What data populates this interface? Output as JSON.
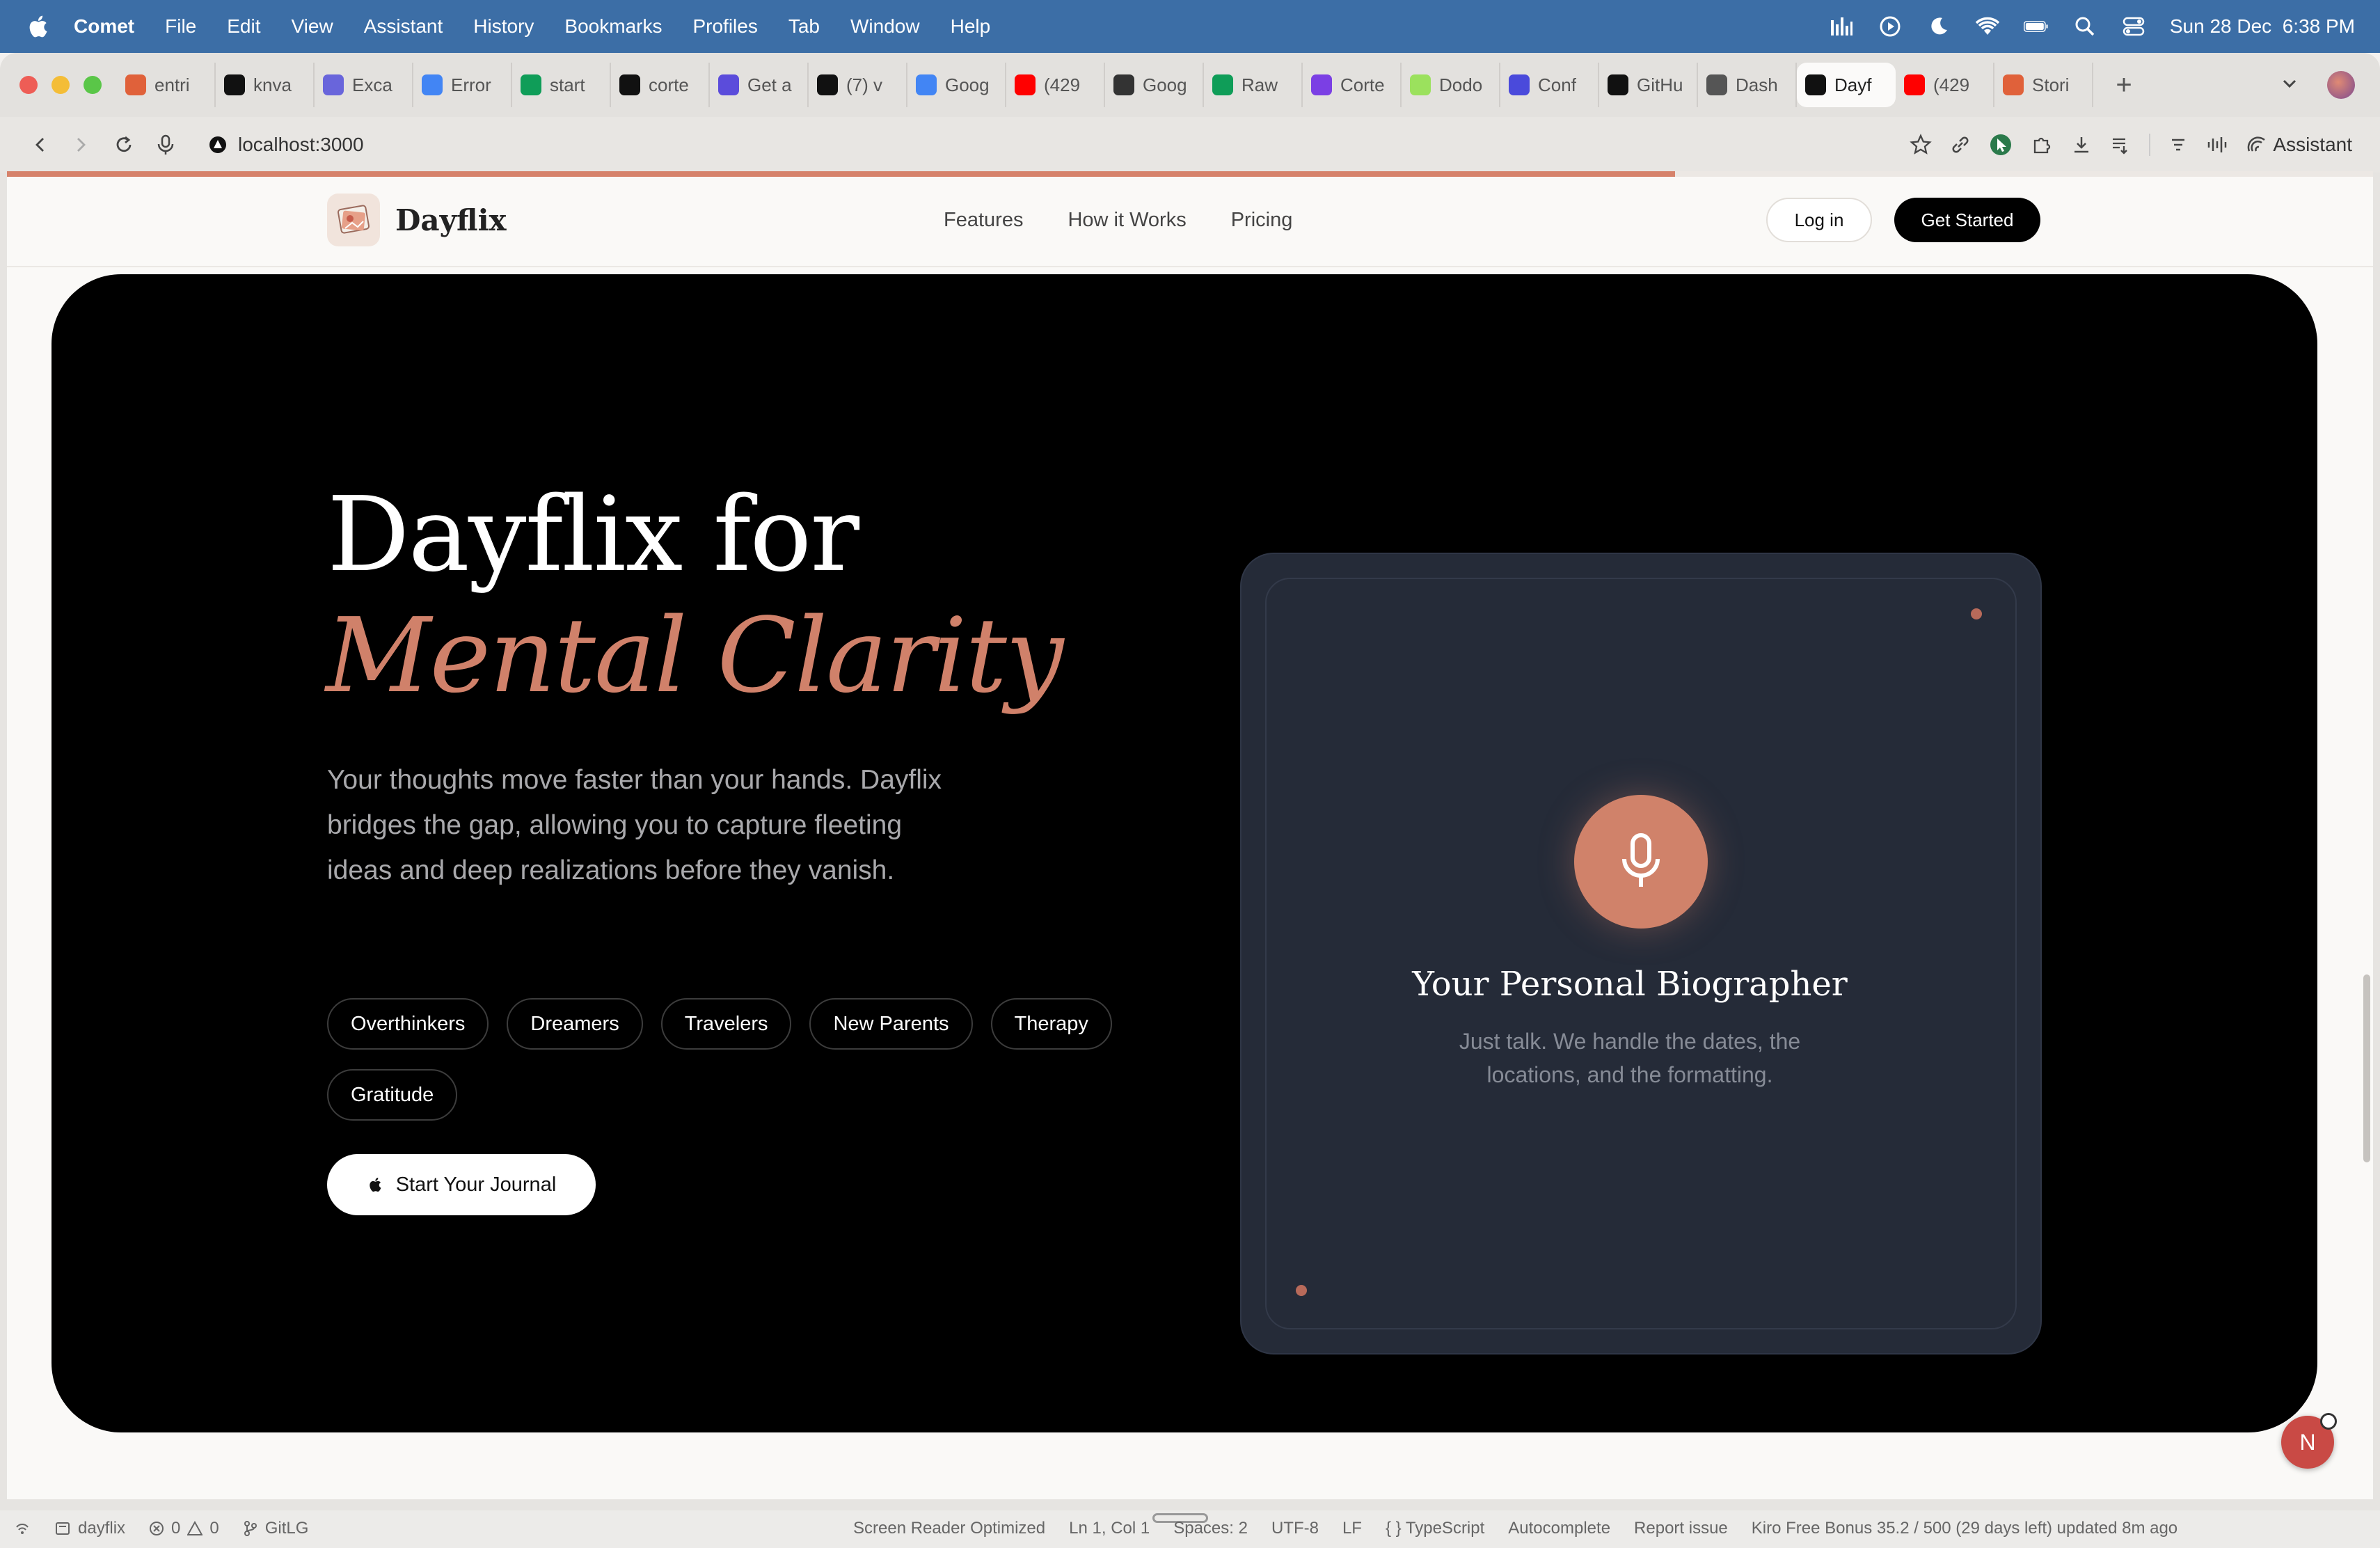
{
  "menubar": {
    "app": "Comet",
    "items": [
      "File",
      "Edit",
      "View",
      "Assistant",
      "History",
      "Bookmarks",
      "Profiles",
      "Tab",
      "Window",
      "Help"
    ],
    "clock": "Sun 28 Dec  6:38 PM"
  },
  "tabs": [
    {
      "label": "entri",
      "color": "#e0613a"
    },
    {
      "label": "knva",
      "color": "#111111"
    },
    {
      "label": "Exca",
      "color": "#6965db"
    },
    {
      "label": "Error",
      "color": "#4285f4"
    },
    {
      "label": "start",
      "color": "#0f9d58"
    },
    {
      "label": "corte",
      "color": "#111111"
    },
    {
      "label": "Get a",
      "color": "#5b4cdb"
    },
    {
      "label": "(7) v",
      "color": "#111111"
    },
    {
      "label": "Goog",
      "color": "#4285f4"
    },
    {
      "label": "(429",
      "color": "#ff0000"
    },
    {
      "label": "Goog",
      "color": "#333333"
    },
    {
      "label": "Raw",
      "color": "#0f9d58"
    },
    {
      "label": "Corte",
      "color": "#7b3fe4"
    },
    {
      "label": "Dodo",
      "color": "#9be15d"
    },
    {
      "label": "Conf",
      "color": "#4a4adb"
    },
    {
      "label": "GitHu",
      "color": "#111111"
    },
    {
      "label": "Dash",
      "color": "#555555"
    },
    {
      "label": "Dayf",
      "color": "#111111",
      "active": true
    },
    {
      "label": "(429",
      "color": "#ff0000"
    },
    {
      "label": "Stori",
      "color": "#e0613a"
    }
  ],
  "address": {
    "url": "localhost:3000",
    "assistant_label": "Assistant"
  },
  "site": {
    "brand": "Dayflix",
    "nav": [
      "Features",
      "How it Works",
      "Pricing"
    ],
    "login": "Log in",
    "get_started": "Get Started",
    "scroll_progress": 0.705
  },
  "hero": {
    "title_line1": "Dayflix for",
    "title_line2": "Mental Clarity",
    "lead": "Your thoughts move faster than your hands. Dayflix bridges the gap, allowing you to capture fleeting ideas and deep realizations before they vanish.",
    "chips": [
      "Overthinkers",
      "Dreamers",
      "Travelers",
      "New Parents",
      "Therapy",
      "Gratitude"
    ],
    "cta": "Start Your Journal"
  },
  "card": {
    "title": "Your Personal Biographer",
    "subtitle": "Just talk. We handle the dates, the locations, and the formatting."
  },
  "avatar_initial": "N",
  "statusbar": {
    "project": "dayflix",
    "errors": "0",
    "warnings": "0",
    "branch": "GitLG",
    "right": [
      "Screen Reader Optimized",
      "Ln 1, Col 1",
      "Spaces: 2",
      "UTF-8",
      "LF",
      "{ } TypeScript",
      "Autocomplete",
      "Report issue",
      "Kiro Free Bonus 35.2 / 500 (29 days left) updated 8m ago"
    ]
  },
  "colors": {
    "accent": "#d0816a",
    "hero_bg": "#000000",
    "card_bg": "#252b38",
    "menubar": "#3c6ea6"
  }
}
